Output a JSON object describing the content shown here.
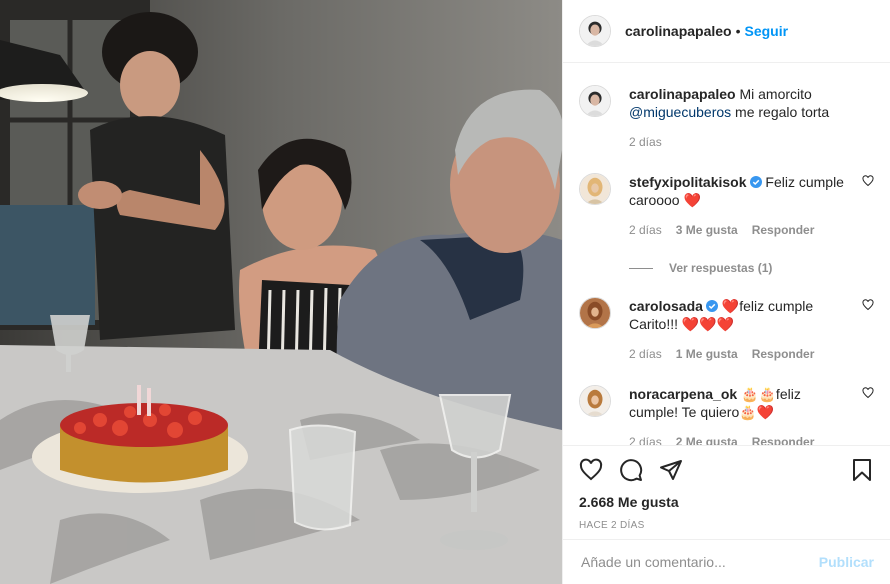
{
  "post": {
    "author": "carolinapapaleo",
    "separator": "•",
    "follow_label": "Seguir",
    "caption": {
      "user": "carolinapapaleo",
      "text_before": " Mi amorcito ",
      "mention": "@miguecuberos",
      "text_after": " me regalo torta",
      "time": "2 días"
    },
    "comments": [
      {
        "user": "stefyxipolitakisok",
        "verified": true,
        "text": " Feliz cumple caroooo ❤️",
        "time": "2 días",
        "likes": "3 Me gusta",
        "reply": "Responder",
        "view_replies": "Ver respuestas (1)"
      },
      {
        "user": "carolosada",
        "verified": true,
        "text": " ❤️feliz cumple Carito!!! ❤️❤️❤️",
        "time": "2 días",
        "likes": "1 Me gusta",
        "reply": "Responder"
      },
      {
        "user": "noracarpena_ok",
        "verified": false,
        "text": " 🎂🎂feliz cumple! Te quiero🎂❤️",
        "time": "2 días",
        "likes": "2 Me gusta",
        "reply": "Responder"
      }
    ],
    "like_count": "2.668 Me gusta",
    "posted_ago": "HACE 2 DÍAS",
    "comment_placeholder": "Añade un comentario...",
    "publish_label": "Publicar",
    "icons": [
      "heart-icon",
      "comment-icon",
      "share-icon",
      "bookmark-icon"
    ],
    "colors": {
      "accent": "#0095f6",
      "publish_disabled": "#b2dffc",
      "like_heart": "#ed4956"
    }
  }
}
